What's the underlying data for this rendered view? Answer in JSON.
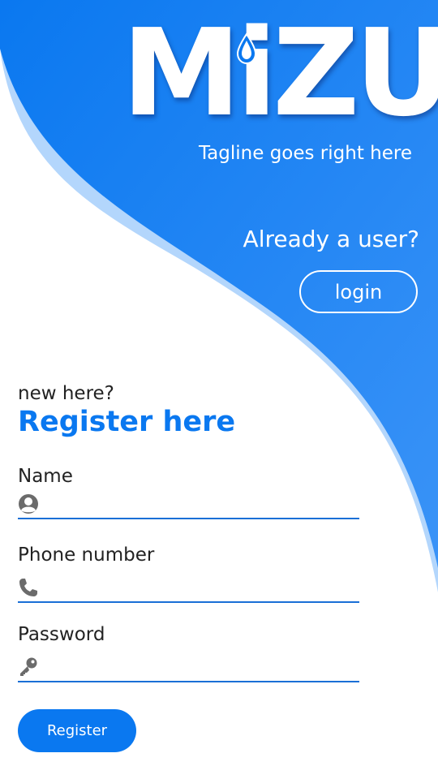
{
  "brand": {
    "logo_text": "MiZU",
    "tagline": "Tagline goes right here"
  },
  "login_section": {
    "prompt": "Already a user?",
    "login_label": "login"
  },
  "register_section": {
    "intro": "new here?",
    "title": "Register here",
    "fields": {
      "name": {
        "label": "Name",
        "icon": "user-icon",
        "value": "",
        "placeholder": ""
      },
      "phone": {
        "label": "Phone number",
        "icon": "phone-icon",
        "value": "",
        "placeholder": ""
      },
      "password": {
        "label": "Password",
        "icon": "key-icon",
        "value": "",
        "placeholder": ""
      }
    },
    "submit_label": "Register"
  },
  "colors": {
    "primary": "#0a78f0",
    "primary_light": "#4a9cf8",
    "wave_light": "#b3d6fc",
    "underline": "#1a6fd6",
    "text": "#222222",
    "icon_gray": "#6b6b6b",
    "background": "#ffffff"
  }
}
